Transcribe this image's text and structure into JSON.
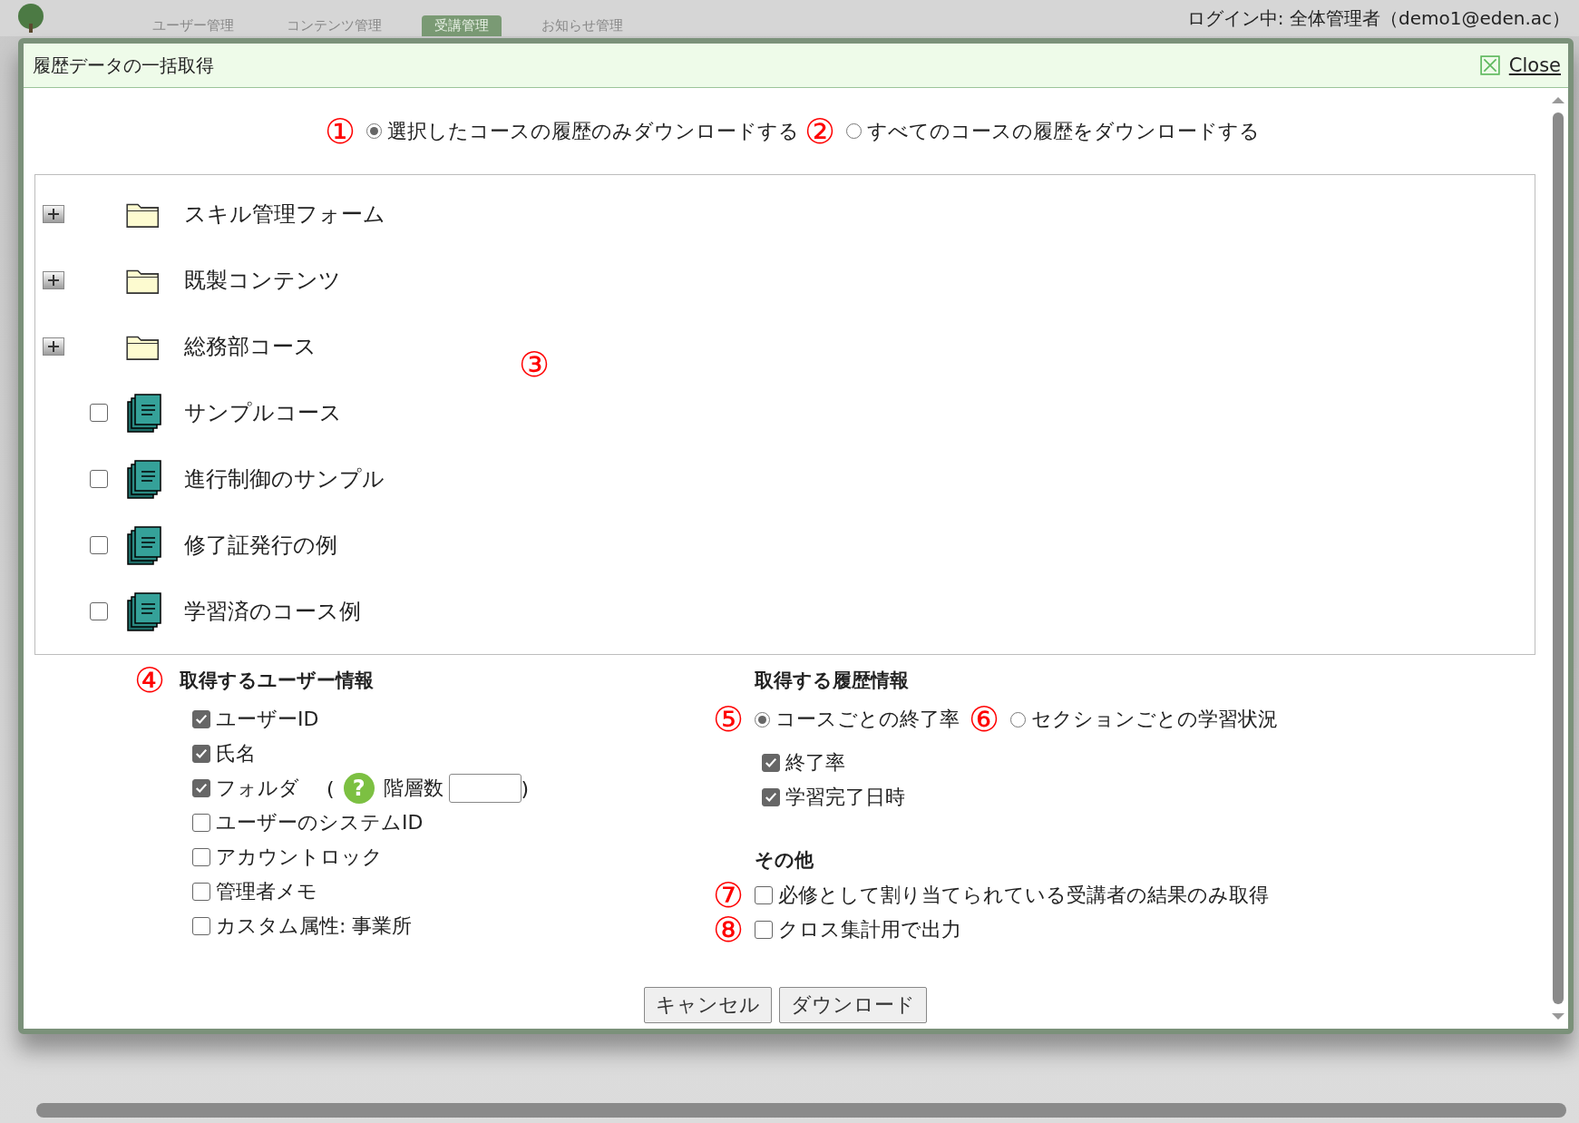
{
  "nav": {
    "tabs": [
      {
        "label": "ユーザー管理",
        "selected": false
      },
      {
        "label": "コンテンツ管理",
        "selected": false
      },
      {
        "label": "受講管理",
        "selected": true
      },
      {
        "label": "お知らせ管理",
        "selected": false
      }
    ],
    "login": "ログイン中: 全体管理者（demo1@eden.ac）"
  },
  "dialog": {
    "title": "履歴データの一括取得",
    "close": "Close",
    "scope": [
      {
        "marker": "①",
        "label": "選択したコースの履歴のみダウンロードする",
        "selected": true
      },
      {
        "marker": "②",
        "label": "すべてのコースの履歴をダウンロードする",
        "selected": false
      }
    ],
    "tree": {
      "marker": "③",
      "items": [
        {
          "kind": "folder",
          "label": "スキル管理フォーム",
          "expanded": false
        },
        {
          "kind": "folder",
          "label": "既製コンテンツ",
          "expanded": false
        },
        {
          "kind": "folder",
          "label": "総務部コース",
          "expanded": false
        },
        {
          "kind": "course",
          "label": "サンプルコース",
          "checked": false
        },
        {
          "kind": "course",
          "label": "進行制御のサンプル",
          "checked": false
        },
        {
          "kind": "course",
          "label": "修了証発行の例",
          "checked": false
        },
        {
          "kind": "course",
          "label": "学習済のコース例",
          "checked": false
        }
      ]
    },
    "user_info": {
      "marker": "④",
      "heading": "取得するユーザー情報",
      "options": [
        {
          "kind": "plain",
          "label": "ユーザーID",
          "checked": true
        },
        {
          "kind": "plain",
          "label": "氏名",
          "checked": true
        },
        {
          "kind": "depth",
          "label": "フォルダ",
          "checked": true,
          "open": "(",
          "help": "?",
          "field_label": "階層数",
          "close": ")"
        },
        {
          "kind": "plain",
          "label": "ユーザーのシステムID",
          "checked": false
        },
        {
          "kind": "plain",
          "label": "アカウントロック",
          "checked": false
        },
        {
          "kind": "plain",
          "label": "管理者メモ",
          "checked": false
        },
        {
          "kind": "plain",
          "label": "カスタム属性: 事業所",
          "checked": false
        }
      ]
    },
    "history_info": {
      "heading": "取得する履歴情報",
      "modes": [
        {
          "marker": "⑤",
          "label": "コースごとの終了率",
          "selected": true
        },
        {
          "marker": "⑥",
          "label": "セクションごとの学習状況",
          "selected": false
        }
      ],
      "options": [
        {
          "label": "終了率",
          "checked": true
        },
        {
          "label": "学習完了日時",
          "checked": true
        }
      ]
    },
    "other": {
      "heading": "その他",
      "options": [
        {
          "marker": "⑦",
          "label": "必修として割り当てられている受講者の結果のみ取得",
          "checked": false
        },
        {
          "marker": "⑧",
          "label": "クロス集計用で出力",
          "checked": false
        }
      ]
    },
    "buttons": [
      "キャンセル",
      "ダウンロード"
    ]
  }
}
